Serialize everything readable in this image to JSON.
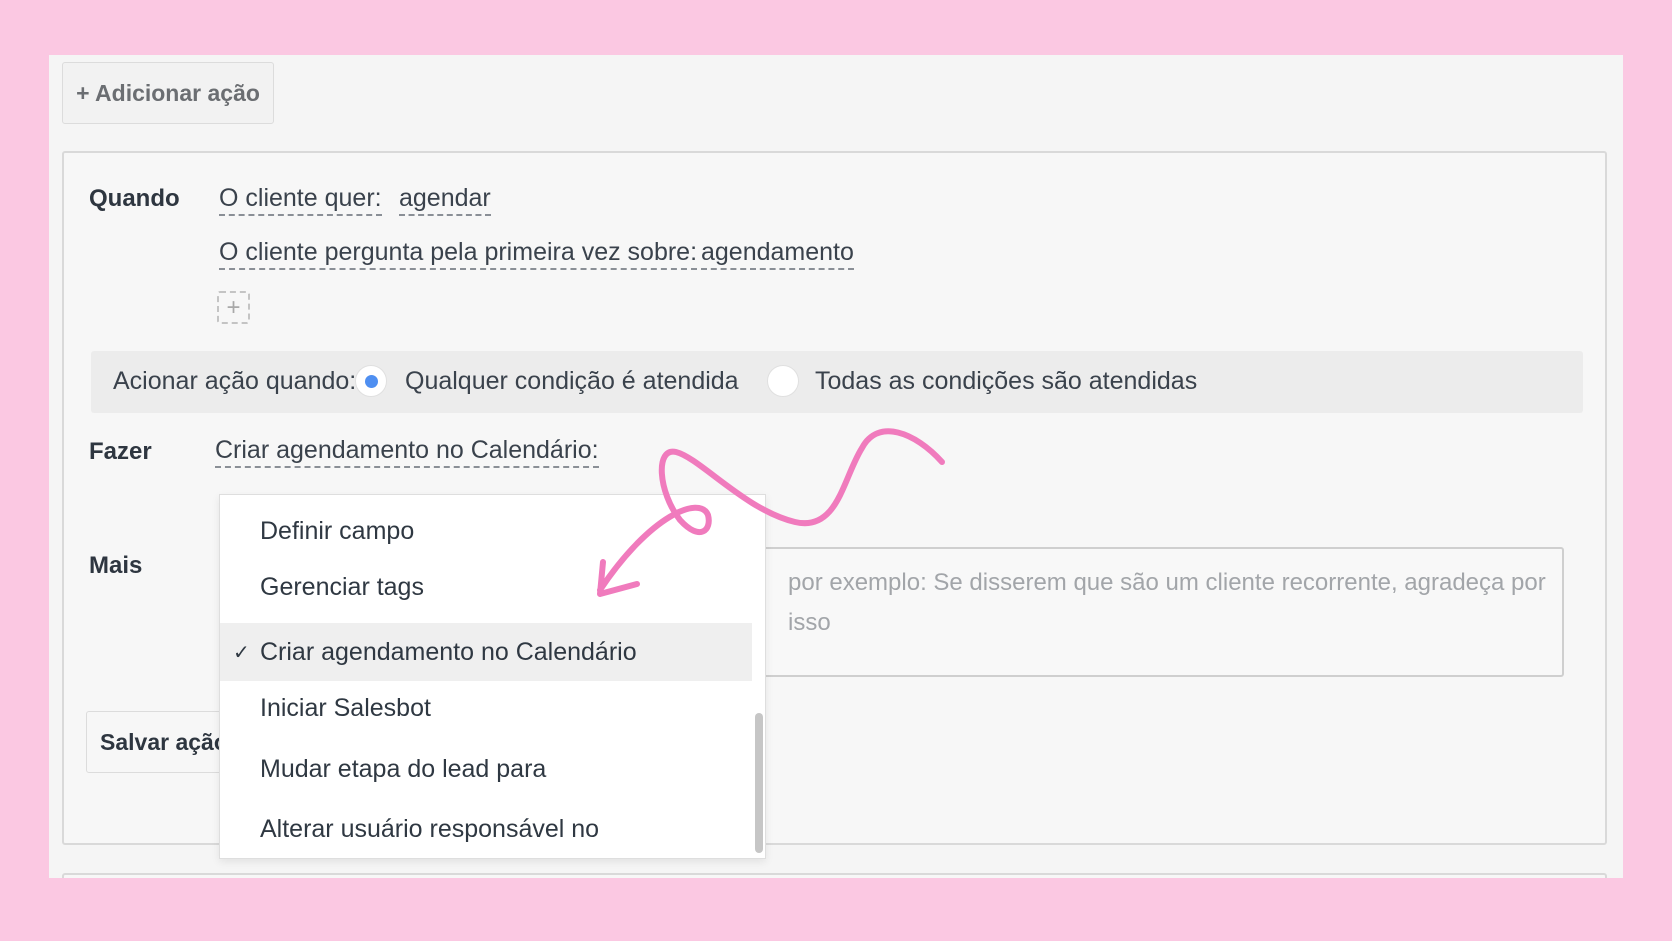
{
  "toolbar": {
    "add_action_label": "+ Adicionar ação"
  },
  "when": {
    "label": "Quando",
    "conditions": [
      {
        "field": "O cliente quer:",
        "value": "agendar"
      },
      {
        "field": "O cliente pergunta pela primeira vez sobre:",
        "value": "agendamento"
      }
    ],
    "add_condition_symbol": "+"
  },
  "trigger": {
    "label": "Acionar ação quando:",
    "options": [
      {
        "label": "Qualquer condição é atendida",
        "selected": true
      },
      {
        "label": "Todas as condições são atendidas",
        "selected": false
      }
    ]
  },
  "do": {
    "label": "Fazer",
    "selected_action": "Criar agendamento no Calendário:",
    "dropdown_items": [
      {
        "label": "Definir campo",
        "selected": false
      },
      {
        "label": "Gerenciar tags",
        "selected": false
      },
      {
        "label": "Criar agendamento no Calendário",
        "selected": true
      },
      {
        "label": "Iniciar Salesbot",
        "selected": false
      },
      {
        "label": "Mudar etapa do lead para",
        "selected": false
      },
      {
        "label": "Alterar usuário responsável no",
        "selected": false
      }
    ],
    "check_glyph": "✓"
  },
  "more": {
    "label": "Mais",
    "placeholder": "por exemplo: Se disserem que são um cliente recorrente, agradeça por isso"
  },
  "save_button_label": "Salvar ação",
  "colors": {
    "background": "#fbc8e2",
    "radio_accent": "#4f8ff1",
    "doodle": "#f07bbd"
  }
}
